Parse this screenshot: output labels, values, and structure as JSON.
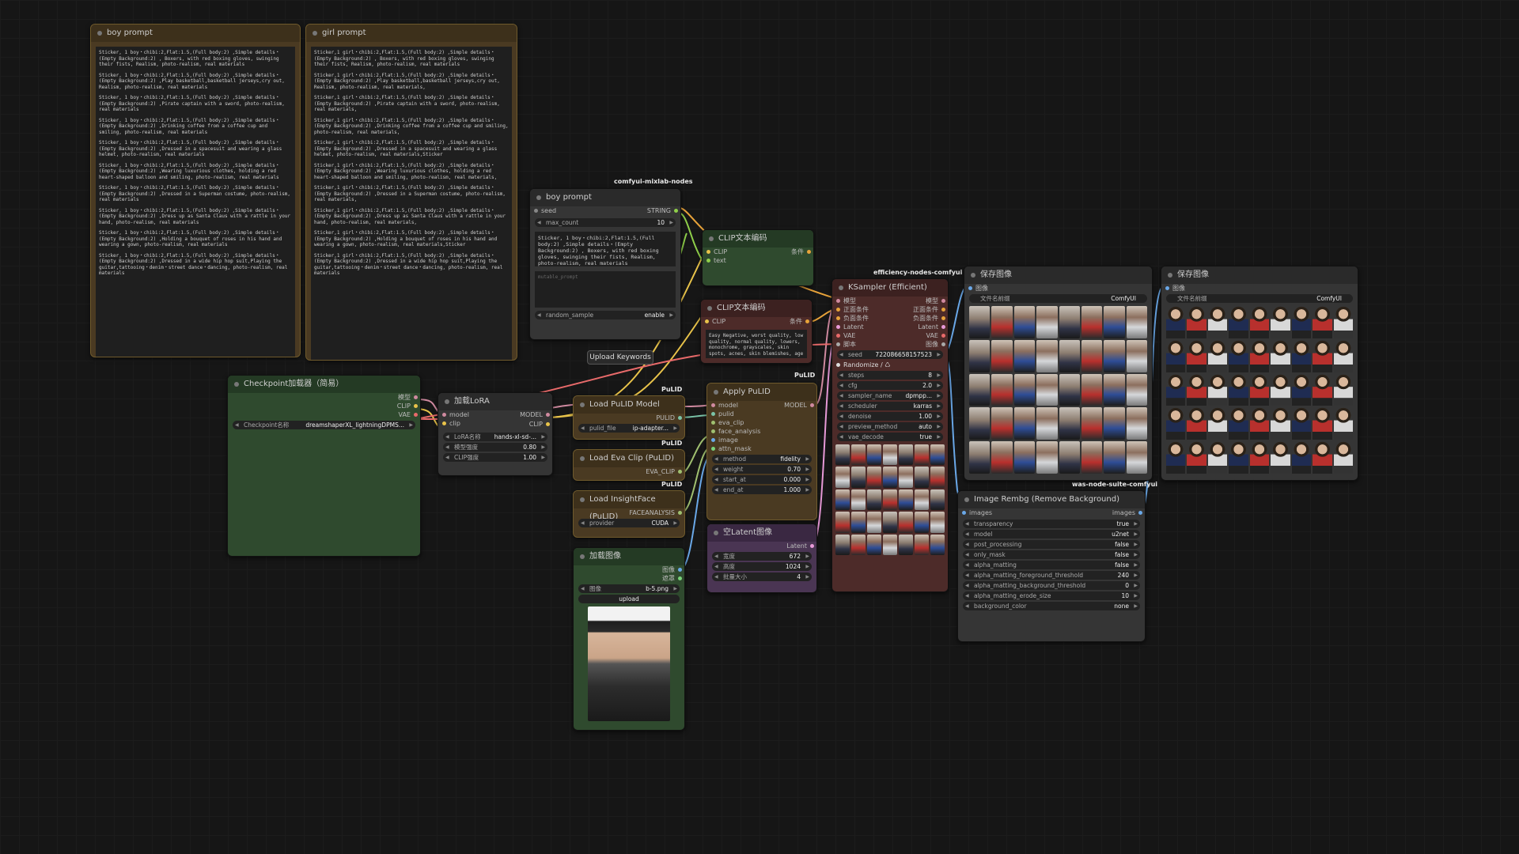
{
  "nodes": {
    "boy_prompt_big": {
      "title": "boy prompt",
      "lines": [
        "Sticker, 1 boy・chibi:2,Flat:1.5,(Full body:2) ,Simple details・(Empty Background:2) , Boxers, with red boxing gloves, swinging their fists, Realism, photo-realism, real materials",
        "Sticker, 1 boy・chibi:2,Flat:1.5,(Full body:2) ,Simple details・(Empty Background:2) ,Play basketball,basketball jerseys,cry out, Realism, photo-realism, real materials",
        "Sticker, 1 boy・chibi:2,Flat:1.5,(Full body:2) ,Simple details・(Empty Background:2) ,Pirate captain with a sword, photo-realism, real materials",
        "Sticker, 1 boy・chibi:2,Flat:1.5,(Full body:2) ,Simple details・(Empty Background:2) ,Drinking coffee from a coffee cup and smiling, photo-realism, real materials",
        "Sticker, 1 boy・chibi:2,Flat:1.5,(Full body:2) ,Simple details・(Empty Background:2) ,Dressed in a spacesuit and wearing a glass helmet, photo-realism, real materials",
        "Sticker, 1 boy・chibi:2,Flat:1.5,(Full body:2) ,Simple details・(Empty Background:2) ,Wearing luxurious clothes, holding a red heart-shaped balloon and smiling, photo-realism, real materials",
        "Sticker, 1 boy・chibi:2,Flat:1.5,(Full body:2) ,Simple details・(Empty Background:2) ,Dressed in a Superman costume, photo-realism, real materials",
        "Sticker, 1 boy・chibi:2,Flat:1.5,(Full body:2) ,Simple details・(Empty Background:2) ,Dress up as Santa Claus with a rattle in your hand, photo-realism, real materials",
        "Sticker, 1 boy・chibi:2,Flat:1.5,(Full body:2) ,Simple details・(Empty Background:2) ,Holding a bouquet of roses in his hand and wearing a gown, photo-realism, real materials",
        "Sticker, 1 boy・chibi:2,Flat:1.5,(Full body:2) ,Simple details・(Empty Background:2) ,Dressed in a wide hip hop suit,Playing the guitar,tattooing・denim・street dance・dancing, photo-realism, real materials"
      ]
    },
    "girl_prompt": {
      "title": "girl prompt",
      "lines": [
        "Sticker,1 girl・chibi:2,Flat:1.5,(Full body:2) ,Simple details・(Empty Background:2) , Boxers, with red boxing gloves, swinging their fists, Realism, photo-realism, real materials",
        "Sticker,1 girl・chibi:2,Flat:1.5,(Full body:2) ,Simple details・(Empty Background:2) ,Play basketball,basketball jerseys,cry out, Realism, photo-realism, real materials,",
        "Sticker,1 girl・chibi:2,Flat:1.5,(Full body:2) ,Simple details・(Empty Background:2) ,Pirate captain with a sword, photo-realism, real materials,",
        "Sticker,1 girl・chibi:2,Flat:1.5,(Full body:2) ,Simple details・(Empty Background:2) ,Drinking coffee from a coffee cup and smiling, photo-realism, real materials,",
        "Sticker,1 girl・chibi:2,Flat:1.5,(Full body:2) ,Simple details・(Empty Background:2) ,Dressed in a spacesuit and wearing a glass helmet, photo-realism, real materials,Sticker",
        "Sticker,1 girl・chibi:2,Flat:1.5,(Full body:2) ,Simple details・(Empty Background:2) ,Wearing luxurious clothes, holding a red heart-shaped balloon and smiling, photo-realism, real materials,",
        "Sticker,1 girl・chibi:2,Flat:1.5,(Full body:2) ,Simple details・(Empty Background:2) ,Dressed in a Superman costume, photo-realism, real materials,",
        "Sticker,1 girl・chibi:2,Flat:1.5,(Full body:2) ,Simple details・(Empty Background:2) ,Dress up as Santa Claus with a rattle in your hand, photo-realism, real materials,",
        "Sticker,1 girl・chibi:2,Flat:1.5,(Full body:2) ,Simple details・(Empty Background:2) ,Holding a bouquet of roses in his hand and wearing a gown, photo-realism, real materials,Sticker",
        "Sticker,1 girl・chibi:2,Flat:1.5,(Full body:2) ,Simple details・(Empty Background:2) ,Dressed in a wide hip hop suit,Playing the guitar,tattooing・denim・street dance・dancing, photo-realism, real materials"
      ]
    },
    "boy_prompt_small": {
      "title": "boy prompt",
      "pack_tag": "comfyui-mixlab-nodes",
      "seed_label": "seed",
      "seed_out": "STRING",
      "max_count_label": "max_count",
      "max_count_value": "10",
      "text": "Sticker, 1 boy・chibi:2,Flat:1.5,(Full body:2) ,Simple details・(Empty Background:2) , Boxers, with red boxing gloves, swinging their fists, Realism, photo-realism, real materials",
      "mutable_placeholder": "mutable_prompt",
      "random_label": "random_sample",
      "random_value": "enable",
      "button": "Upload Keywords"
    },
    "clip_text_1": {
      "title": "CLIP文本编码",
      "in_clip": "CLIP",
      "in_text": "text",
      "out": "条件"
    },
    "clip_text_2": {
      "title": "CLIP文本编码",
      "in_clip": "CLIP",
      "out": "条件",
      "text": "Easy Negative, worst quality, low quality, normal quality, lowers, monochrome, grayscales, skin spots, acnes, skin blemishes, age"
    },
    "checkpoint": {
      "title": "Checkpoint加载器（简易）",
      "out1": "模型",
      "out2": "CLIP",
      "out3": "VAE",
      "widget_label": "Checkpoint名称",
      "widget_value": "dreamshaperXL_lightningDPMS..."
    },
    "lora": {
      "title": "加载LoRA",
      "in_model": "model",
      "in_clip": "clip",
      "out_model": "MODEL",
      "out_clip": "CLIP",
      "w1l": "LoRA名称",
      "w1v": "hands-xl-sd-...",
      "w2l": "模型强度",
      "w2v": "0.80",
      "w3l": "CLIP强度",
      "w3v": "1.00"
    },
    "pulid_model": {
      "title": "Load PuLID Model",
      "tag": "PuLID",
      "out": "PULID",
      "wl": "pulid_file",
      "wv": "ip-adapter..."
    },
    "eva_clip": {
      "title": "Load Eva Clip (PuLID)",
      "tag": "PuLID",
      "out": "EVA_CLIP"
    },
    "insightface": {
      "title": "Load InsightFace (PuLID)",
      "tag": "PuLID",
      "out": "FACEANALYSIS",
      "wl": "provider",
      "wv": "CUDA"
    },
    "load_image": {
      "title": "加载图像",
      "out1": "图像",
      "out2": "遮罩",
      "wl": "图像",
      "wv": "b-5.png",
      "upload": "upload"
    },
    "apply_pulid": {
      "title": "Apply PuLID",
      "tag": "PuLID",
      "inputs": [
        "model",
        "pulid",
        "eva_clip",
        "face_analysis",
        "image",
        "attn_mask"
      ],
      "out": "MODEL",
      "widgets": [
        [
          "method",
          "fidelity"
        ],
        [
          "weight",
          "0.70"
        ],
        [
          "start_at",
          "0.000"
        ],
        [
          "end_at",
          "1.000"
        ]
      ]
    },
    "empty_latent": {
      "title": "空Latent图像",
      "out": "Latent",
      "widgets": [
        [
          "宽度",
          "672"
        ],
        [
          "高度",
          "1024"
        ],
        [
          "批量大小",
          "4"
        ]
      ]
    },
    "ksampler": {
      "title": "KSampler (Efficient)",
      "pack_tag": "efficiency-nodes-comfyui",
      "slots": [
        [
          "模型",
          "模型"
        ],
        [
          "正面条件",
          "正面条件"
        ],
        [
          "负面条件",
          "负面条件"
        ],
        [
          "Latent",
          "Latent"
        ],
        [
          "VAE",
          "VAE"
        ],
        [
          "脚本",
          "图像"
        ]
      ],
      "seed_label": "seed",
      "seed_value": "722086658157523",
      "randomize": "Randomize / ♺ 722086658157523",
      "widgets": [
        [
          "steps",
          "8"
        ],
        [
          "cfg",
          "2.0"
        ],
        [
          "sampler_name",
          "dpmpp..."
        ],
        [
          "scheduler",
          "karras"
        ],
        [
          "denoise",
          "1.00"
        ],
        [
          "preview_method",
          "auto"
        ],
        [
          "vae_decode",
          "true"
        ]
      ]
    },
    "save_1": {
      "title": "保存图像",
      "in": "图像",
      "wl": "文件名前缀",
      "wv": "ComfyUI"
    },
    "save_2": {
      "title": "保存图像",
      "in": "图像",
      "wl": "文件名前缀",
      "wv": "ComfyUI"
    },
    "rembg": {
      "title": "Image Rembg (Remove Background)",
      "pack_tag": "was-node-suite-comfyui",
      "in": "images",
      "out": "images",
      "widgets": [
        [
          "transparency",
          "true"
        ],
        [
          "model",
          "u2net"
        ],
        [
          "post_processing",
          "false"
        ],
        [
          "only_mask",
          "false"
        ],
        [
          "alpha_matting",
          "false"
        ],
        [
          "alpha_matting_foreground_threshold",
          "240"
        ],
        [
          "alpha_matting_background_threshold",
          "0"
        ],
        [
          "alpha_matting_erode_size",
          "10"
        ],
        [
          "background_color",
          "none"
        ]
      ]
    }
  }
}
